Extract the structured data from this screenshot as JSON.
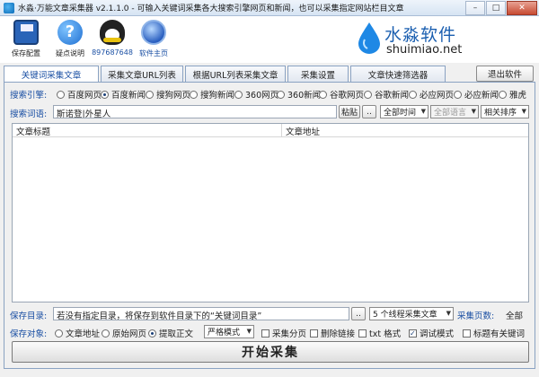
{
  "window": {
    "title": "水淼·万能文章采集器 v2.1.1.0 - 可输入关键词采集各大搜索引擎网页和新闻，也可以采集指定网站栏目文章",
    "minimize": "–",
    "maximize": "□",
    "close": "✕"
  },
  "toolbar": {
    "save_label": "保存配置",
    "help_label": "疑点说明",
    "qq_label": "89768764​8",
    "home_label": "软件主页"
  },
  "brand": {
    "name": "水淼软件",
    "url": "shuimiao.net"
  },
  "tabs": [
    {
      "label": "关键词采集文章"
    },
    {
      "label": "采集文章URL列表"
    },
    {
      "label": "根据URL列表采集文章"
    },
    {
      "label": "采集设置"
    },
    {
      "label": "文章快速筛选器"
    }
  ],
  "exit_label": "退出软件",
  "engine": {
    "label": "搜索引擎:",
    "options": [
      "百度网页",
      "百度新闻",
      "搜狗网页",
      "搜狗新闻",
      "360网页",
      "360新闻",
      "谷歌网页",
      "谷歌新闻",
      "必应网页",
      "必应新闻",
      "雅虎"
    ],
    "selected_index": 1
  },
  "keywords": {
    "label": "搜索词语:",
    "value": "斯诺登|外星人",
    "paste_label": "粘贴",
    "more_label": "..",
    "time_select": "全部时间",
    "lang_select": "全部语言",
    "sort_select": "相关排序"
  },
  "grid": {
    "columns": [
      "文章标题",
      "文章地址"
    ]
  },
  "savedir": {
    "label": "保存目录:",
    "value": "若没有指定目录，将保存到软件目录下的“关键词目录”",
    "browse_label": "..",
    "threads_select": "5 个线程采集文章",
    "pages_label": "采集页数:",
    "pages_value": "全部"
  },
  "saveobj": {
    "label": "保存对象:",
    "radios": [
      "文章地址",
      "原始网页",
      "提取正文"
    ],
    "selected_index": 2,
    "mode_select": "严格模式",
    "checks": [
      {
        "label": "采集分页",
        "checked": false
      },
      {
        "label": "删除链接",
        "checked": false
      },
      {
        "label": "txt 格式",
        "checked": false
      },
      {
        "label": "调试模式",
        "checked": true
      },
      {
        "label": "标题有关键词",
        "checked": false
      }
    ]
  },
  "start_label": "开始采集"
}
